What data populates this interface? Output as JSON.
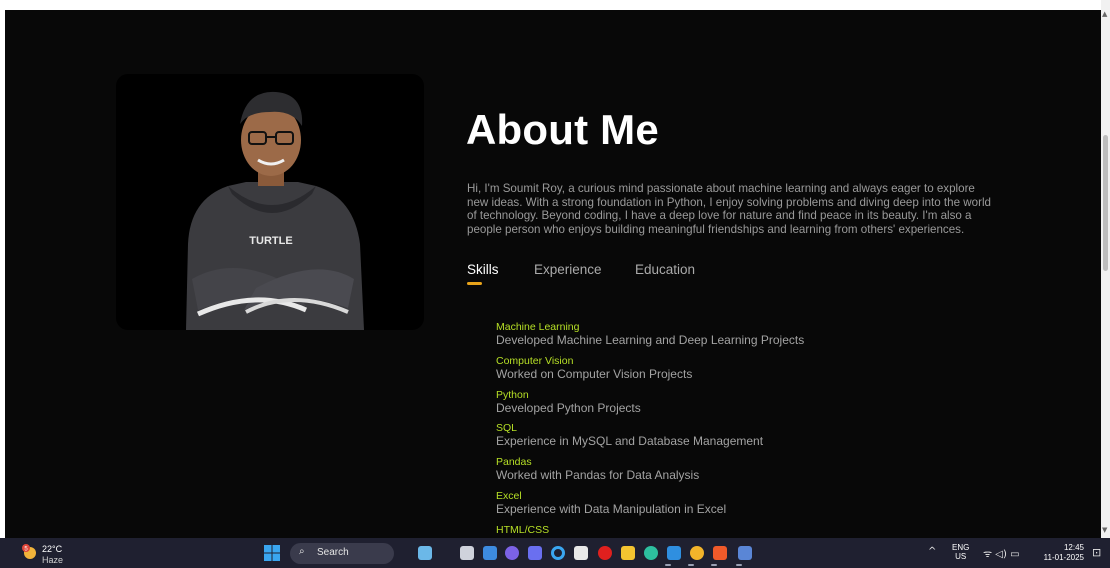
{
  "page": {
    "about_title": "About Me",
    "about_text": "Hi, I'm Soumit Roy, a curious mind passionate about machine learning and always eager to explore new ideas. With a strong foundation in Python, I enjoy solving problems and diving deep into the world of technology. Beyond coding, I have a deep love for nature and find peace in its beauty. I'm also a people person who enjoys building meaningful friendships and learning from others' experiences.",
    "photo_shirt_text": "TURTLE",
    "tabs": [
      {
        "label": "Skills",
        "active": true
      },
      {
        "label": "Experience",
        "active": false
      },
      {
        "label": "Education",
        "active": false
      }
    ],
    "skills": [
      {
        "name": "Machine Learning",
        "desc": "Developed Machine Learning and Deep Learning Projects"
      },
      {
        "name": "Computer Vision",
        "desc": "Worked on Computer Vision Projects"
      },
      {
        "name": "Python",
        "desc": "Developed Python Projects"
      },
      {
        "name": "SQL",
        "desc": "Experience in MySQL and Database Management"
      },
      {
        "name": "Pandas",
        "desc": "Worked with Pandas for Data Analysis"
      },
      {
        "name": "Excel",
        "desc": "Experience with Data Manipulation in Excel"
      },
      {
        "name": "HTML/CSS",
        "desc": ""
      }
    ],
    "colors": {
      "background": "#080808",
      "accent_underline": "#e8a31a",
      "skill_name": "#b7e026"
    }
  },
  "taskbar": {
    "weather_temp": "22°C",
    "weather_condition": "Haze",
    "weather_badge": "5",
    "search_label": "Search",
    "tray_lang_line1": "ENG",
    "tray_lang_line2": "US",
    "time": "12:45",
    "date": "11-01-2025",
    "apps": [
      "widgets-icon",
      "task-view-icon",
      "store-icon",
      "copilot-icon",
      "teams-icon",
      "cortana-icon",
      "notepad-icon",
      "opera-icon",
      "file-explorer-icon",
      "edge-icon",
      "vscode-icon",
      "chrome-icon",
      "brave-icon",
      "task-manager-icon"
    ]
  }
}
